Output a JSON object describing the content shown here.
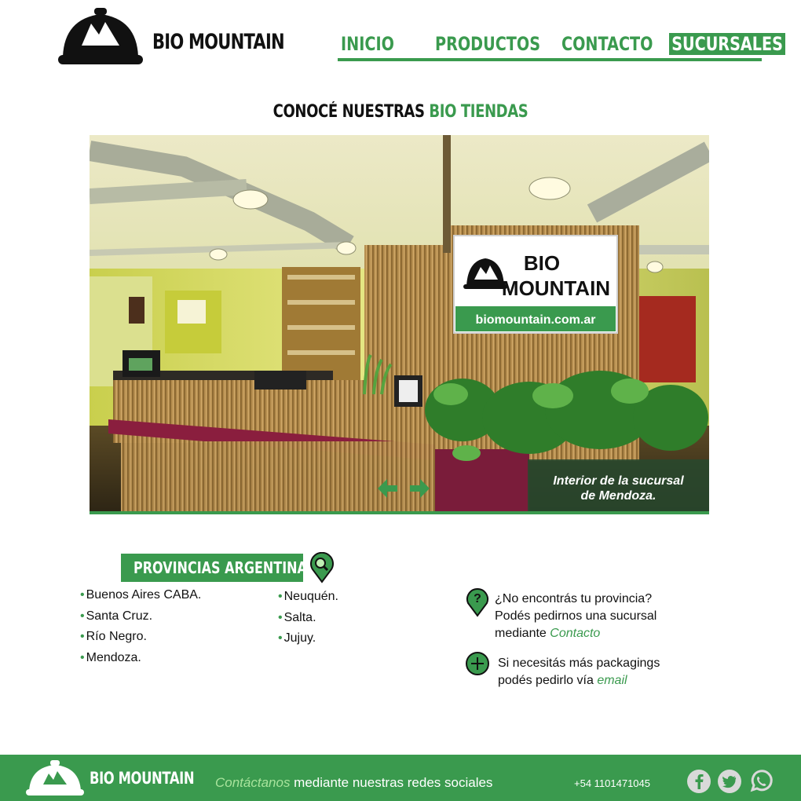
{
  "header": {
    "brand": "BIO MOUNTAIN",
    "nav": [
      {
        "label": "INICIO",
        "active": false
      },
      {
        "label": "PRODUCTOS",
        "active": false
      },
      {
        "label": "CONTACTO",
        "active": false
      },
      {
        "label": "SUCURSALES",
        "active": true
      }
    ]
  },
  "section_title": {
    "plain": "CONOCÉ NUESTRAS ",
    "accent": "BIO TIENDAS"
  },
  "hero": {
    "caption_line1": "Interior de la sucursal",
    "caption_line2": "de Mendoza.",
    "sign_line1": "BIO",
    "sign_line2": "MOUNTAIN",
    "sign_url": "biomountain.com.ar",
    "prev_icon": "arrow-left-icon",
    "next_icon": "arrow-right-icon"
  },
  "provinces": {
    "title": "PROVINCIAS ARGENTINAS",
    "icon": "location-search-icon",
    "col1": [
      "Buenos Aires CABA.",
      "Santa Cruz.",
      "Río Negro.",
      "Mendoza."
    ],
    "col2": [
      "Neuquén.",
      "Salta.",
      "Jujuy."
    ]
  },
  "info": {
    "question_icon": "question-pin-icon",
    "q_line1": "¿No encontrás tu provincia?",
    "q_line2": "Podés pedirnos una sucursal",
    "q_line3_prefix": "mediante ",
    "q_link": "Contacto",
    "plus_icon": "plus-circle-icon",
    "p_line1": "Si necesitás más packagings",
    "p_line2_prefix": "podés pedirlo vía ",
    "p_link": "email"
  },
  "footer": {
    "brand": "BIO MOUNTAIN",
    "contact_emphasis": "Contáctanos",
    "contact_rest": " mediante nuestras redes sociales",
    "phone": "+54 1101471045",
    "social": [
      "facebook-icon",
      "twitter-icon",
      "whatsapp-icon"
    ]
  },
  "colors": {
    "accent": "#3a9a4e",
    "text": "#111111",
    "background": "#ffffff"
  }
}
